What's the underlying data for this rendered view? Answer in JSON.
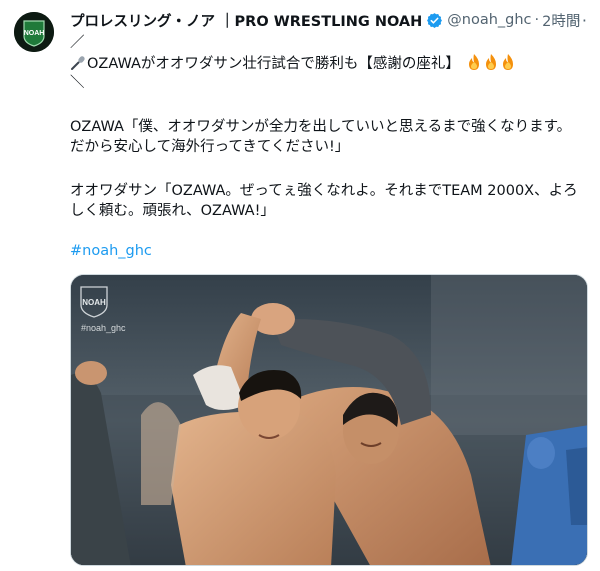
{
  "tweet": {
    "display_name": "プロレスリング・ノア ｜PRO WRESTLING NOAH",
    "handle": "@noah_ghc",
    "separator": "·",
    "time": "2時間",
    "more": "···",
    "lines": [
      "／",
      "OZAWAがオオワダサン壮行試合で勝利も【感謝の座礼】",
      "＼",
      "OZAWA「僕、オオワダサンが全力を出していいと思えるまで強くなります。",
      "だから安心して海外行ってきてください!」",
      "オオワダサン「OZAWA。ぜってぇ強くなれよ。それまでTEAM 2000X、よろ",
      "しく頼む。頑張れ、OZAWA!」"
    ],
    "hashtag": "#noah_ghc",
    "icons": [
      "noah-logo",
      "verified-badge",
      "microphone-emoji",
      "fire-emoji"
    ],
    "colors": {
      "link": "#1d9bf0",
      "text": "#0f1419",
      "muted": "#536471",
      "verified": "#1d9bf0"
    }
  },
  "avatar": {
    "logo_text": "NOAH"
  },
  "media": {
    "logo_text": "NOAH",
    "overlay_text": "#noah_ghc"
  }
}
